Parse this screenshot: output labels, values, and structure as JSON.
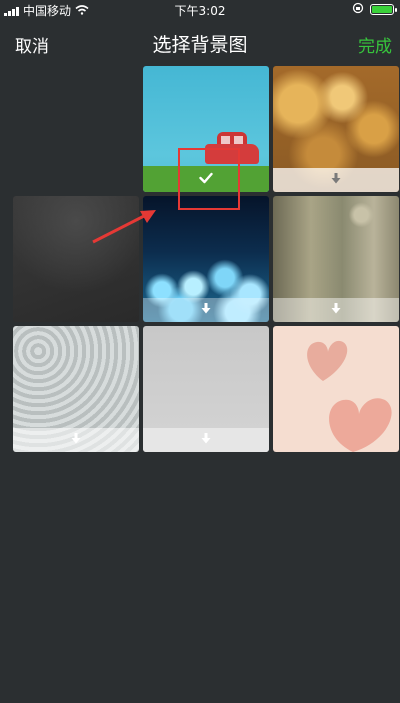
{
  "status_bar": {
    "carrier": "中国移动",
    "time": "下午3:02"
  },
  "nav": {
    "cancel_label": "取消",
    "title": "选择背景图",
    "done_label": "完成",
    "done_color": "#37c43c"
  },
  "backgrounds": [
    {
      "name": "blue-sky-red-car",
      "state": "selected",
      "icon": "checkmark-icon"
    },
    {
      "name": "golden-bokeh",
      "state": "download",
      "icon": "download-arrow-icon"
    },
    {
      "name": "dark-texture",
      "state": "available"
    },
    {
      "name": "blue-bokeh",
      "state": "download",
      "icon": "download-arrow-icon"
    },
    {
      "name": "rain-glass",
      "state": "download",
      "icon": "download-arrow-icon"
    },
    {
      "name": "floral-pattern",
      "state": "download",
      "icon": "download-arrow-icon"
    },
    {
      "name": "plain-gray",
      "state": "download",
      "icon": "download-arrow-icon"
    },
    {
      "name": "pink-hearts",
      "state": "available"
    }
  ],
  "colors": {
    "background": "#2b2f31",
    "selected_bar": "#52a234",
    "annotation_red": "#e53935"
  }
}
